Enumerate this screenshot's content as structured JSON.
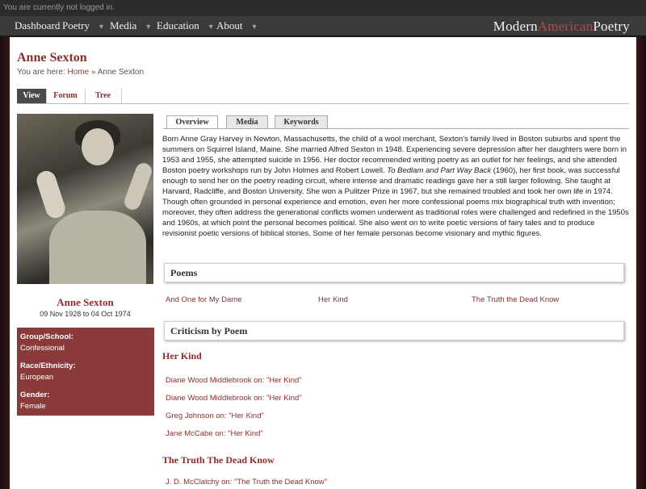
{
  "topbar": {
    "status": "You are currently not logged in."
  },
  "nav": {
    "items": [
      {
        "label": "Dashboard",
        "has_menu": false
      },
      {
        "label": "Poetry",
        "has_menu": true
      },
      {
        "label": "Media",
        "has_menu": true
      },
      {
        "label": "Education",
        "has_menu": true
      },
      {
        "label": "About",
        "has_menu": true
      }
    ],
    "logo": {
      "part1": "Modern",
      "part2": "American",
      "part3": "Poetry"
    }
  },
  "page": {
    "title": "Anne Sexton",
    "breadcrumb": {
      "prefix": "You are here:",
      "home": "Home",
      "sep": "»",
      "current": "Anne Sexton"
    },
    "tabs": [
      "View",
      "Forum",
      "Tree"
    ]
  },
  "poet": {
    "name": "Anne Sexton",
    "dates": "09 Nov 1928 to 04 Oct 1974",
    "info": [
      {
        "label": "Group/School:",
        "value": "Confessional"
      },
      {
        "label": "Race/Ethnicity:",
        "value": "European"
      },
      {
        "label": "Gender:",
        "value": "Female"
      }
    ]
  },
  "subtabs": [
    "Overview",
    "Media",
    "Keywords"
  ],
  "bio": {
    "part1": "Born Anne Gray Harvey in Newton, Massachusetts, the child of a wool merchant, Sexton's family lived in Boston suburbs and spent the summers on Squirrel Island, Maine. She married Alfred Sexton in 1948. Experiencing severe depression after her daughters were born in 1953 and 1955, she attempted suicide in 1956. Her doctor recommended writing poetry as an outlet for her feelings, and she attended Boston poetry workshops run by John Holmes and Robert Lowell.",
    "book": "To Bedlam and Part Way Back",
    "part2": "(1960), her first book, was successful enough to send her on the poetry reading circuit, where intense and dramatic readings gave her a still larger following. She taught at Harvard, Radcliffe, and Boston University. She won a Pulitzer Prize in 1967, but she remained troubled and took her own life in 1974. Though often grounded in personal experience and emotion, even her more confessional poems mix biographical truth with invention; moreover, they often address the generational conflicts women underwent as traditional roles were challenged and redefined in the 1950s and 1960s, at which point the personal becomes political. She also went on to write poetic versions of fairy tales and to produce revisionist poetic versions of biblical stories. Some of her female personas become visionary and mythic figures."
  },
  "poems": {
    "title": "Poems",
    "items": [
      "And One for My Dame",
      "Her Kind",
      "The Truth the Dead Know"
    ]
  },
  "criticism": {
    "title": "Criticism by Poem",
    "groups": [
      {
        "poem": "Her Kind",
        "links": [
          "Diane Wood Middlebrook on: \"Her Kind\"",
          "Diane Wood Middlebrook on: \"Her Kind\"",
          "Greg Johnson on: \"Her Kind\"",
          "Jane McCabe on: \"Her Kind\""
        ]
      },
      {
        "poem": "The Truth The Dead Know",
        "links": [
          "J. D. McClatchy on: \"The Truth the Dead Know\""
        ]
      }
    ]
  },
  "colors": {
    "accent": "#8b2e2e",
    "info_bg": "#8b3a3a",
    "nav_bg": "#3a3a3a"
  }
}
